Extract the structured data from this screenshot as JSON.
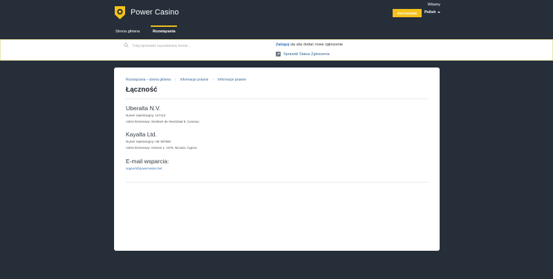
{
  "header": {
    "brand": "Power Casino",
    "welcome": "Witamy",
    "submit_label": "ZGŁOSZENIE",
    "language": "Polish",
    "tabs": [
      {
        "label": "Strona główna"
      },
      {
        "label": "Rozwiązania"
      }
    ],
    "accent_color": "#f5c21b"
  },
  "search": {
    "placeholder": "Tutaj wprowadź wyszukiwany termin...",
    "login_link": "Zaloguj",
    "login_suffix": " się aby dodać nowe zgłoszenie",
    "status_link": "Sprawdź Status Zgłoszenia"
  },
  "card": {
    "breadcrumb": [
      "Rozwiązania – strona główna",
      "Informacje prawne",
      "Informacje prawne"
    ],
    "title": "Łączność",
    "company1": {
      "name": "Uberalta N.V.",
      "reg": "Numer rejestracyjny: 147113",
      "address": "Adres biznesowy: Abraham de Veerstraat 9, Curacao."
    },
    "company2": {
      "name": "Kayalta Ltd.",
      "reg": "Numer rejestracyjny: HE 387690",
      "address": "Adres biznesowy: Avlonos 1, 1075, Nicosia, Cyprus."
    },
    "support": {
      "heading": "E-mail wsparcia:",
      "email": "support@powercasino.bet"
    }
  }
}
